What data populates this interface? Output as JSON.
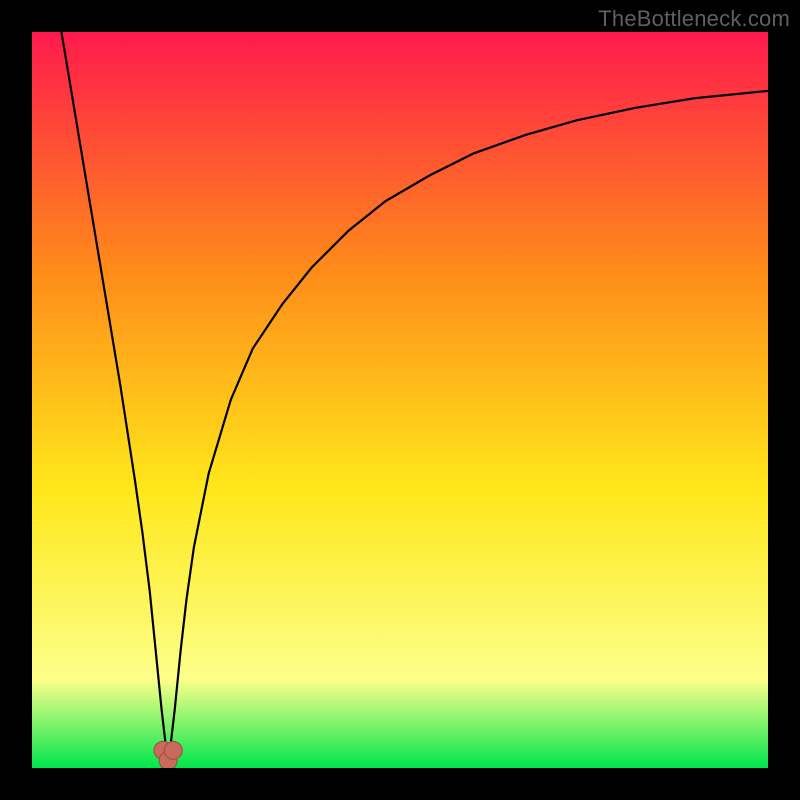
{
  "watermark": {
    "text": "TheBottleneck.com"
  },
  "colors": {
    "bg": "#000000",
    "grad_top": "#ff1a4d",
    "grad_mid1": "#ff8a1a",
    "grad_mid2": "#ffe71a",
    "grad_low": "#fdff8a",
    "grad_bottom": "#00e64d",
    "curve": "#000000",
    "marker_fill": "#c96a5c",
    "marker_stroke": "#9e4a3e"
  },
  "chart_data": {
    "type": "line",
    "title": "",
    "xlabel": "",
    "ylabel": "",
    "xlim": [
      0,
      100
    ],
    "ylim": [
      0,
      100
    ],
    "notch_x": 18.5,
    "series": [
      {
        "name": "bottleneck-curve",
        "x": [
          4,
          6,
          8,
          10,
          12,
          14,
          15,
          16,
          16.8,
          17.6,
          18.3,
          18.5,
          18.7,
          19.4,
          20.2,
          21,
          22,
          24,
          27,
          30,
          34,
          38,
          43,
          48,
          54,
          60,
          67,
          74,
          82,
          90,
          100
        ],
        "y": [
          100,
          88,
          76,
          64,
          52,
          39,
          32,
          24,
          16,
          8,
          2,
          1,
          2,
          8,
          16,
          23,
          30,
          40,
          50,
          57,
          63,
          68,
          73,
          77,
          80.5,
          83.5,
          86,
          88,
          89.7,
          91,
          92
        ]
      }
    ],
    "markers": [
      {
        "x": 17.8,
        "y": 2.4
      },
      {
        "x": 18.5,
        "y": 1.0
      },
      {
        "x": 19.2,
        "y": 2.4
      }
    ]
  }
}
